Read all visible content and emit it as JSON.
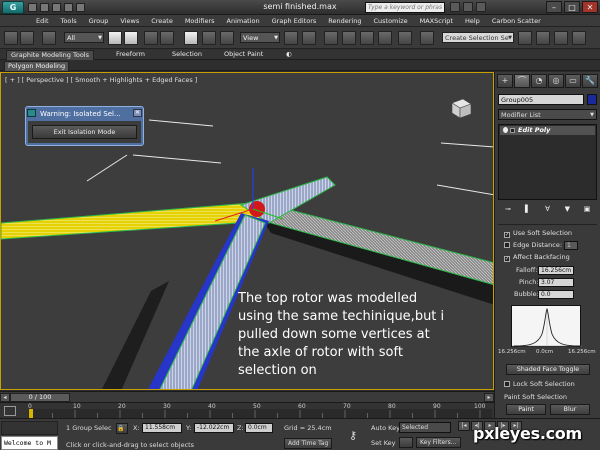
{
  "window": {
    "title": "semi finished.max",
    "search_placeholder": "Type a keyword or phrase"
  },
  "menu": [
    "Edit",
    "Tools",
    "Group",
    "Views",
    "Create",
    "Modifiers",
    "Animation",
    "Graph Editors",
    "Rendering",
    "Customize",
    "MAXScript",
    "Help",
    "Carbon Scatter"
  ],
  "toolbar": {
    "selection_filter": "All",
    "ref_coord": "View",
    "named_selection": "Create Selection Se"
  },
  "ribbon": {
    "tabs": [
      "Graphite Modeling Tools",
      "Freeform",
      "Selection",
      "Object Paint"
    ],
    "sub_tab": "Polygon Modeling"
  },
  "viewport": {
    "label_parts": [
      "[ + ]",
      "[ Perspective ]",
      "[ Smooth + Highlights + Edged Faces ]"
    ],
    "caption": "The top rotor was modelled using the same techinique,but i pulled down some vertices at the axle of rotor with soft selection on"
  },
  "isolation_dialog": {
    "title": "Warning: Isolated Sel...",
    "button": "Exit Isolation Mode"
  },
  "command_panel": {
    "tabs": [
      "+",
      "⌒",
      "◔",
      "◎",
      "▭",
      "🔧"
    ],
    "object_name": "Group005",
    "object_color": "#1a2a9a",
    "modifier_list": "Modifier List",
    "stack_item": "Edit Poly",
    "soft_selection": {
      "use_soft_selection": "Use Soft Selection",
      "edge_distance": "Edge Distance:",
      "edge_distance_value": "1",
      "affect_backfacing": "Affect Backfacing",
      "falloff_label": "Falloff:",
      "falloff_value": "16.256cm",
      "pinch_label": "Pinch:",
      "pinch_value": "3.07",
      "bubble_label": "Bubble:",
      "bubble_value": "0.0",
      "curve_left": "16.256cm",
      "curve_center": "0.0cm",
      "curve_right": "16.256cm",
      "shaded_face_toggle": "Shaded Face Toggle",
      "lock_soft_selection": "Lock Soft Selection",
      "paint_soft_selection": "Paint Soft Selection",
      "paint_button": "Paint",
      "blur_button": "Blur"
    }
  },
  "timeline": {
    "slider": "0 / 100",
    "ticks": [
      "0",
      "10",
      "20",
      "30",
      "40",
      "50",
      "60",
      "70",
      "80",
      "90",
      "100"
    ]
  },
  "status": {
    "listener": "Welcome to M",
    "group_sel": "1 Group Selec",
    "prompt": "Click or click-and-drag to select objects",
    "x_label": "X:",
    "x_value": "11.558cm",
    "y_label": "Y:",
    "y_value": "-12.022cm",
    "z_label": "Z:",
    "z_value": "0.0cm",
    "grid": "Grid = 25.4cm",
    "add_time_tag": "Add Time Tag",
    "auto_key": "Auto Key",
    "auto_key_mode": "Selected",
    "set_key": "Set Key",
    "key_filters": "Key Filters..."
  },
  "watermark": "pxleyes.com"
}
